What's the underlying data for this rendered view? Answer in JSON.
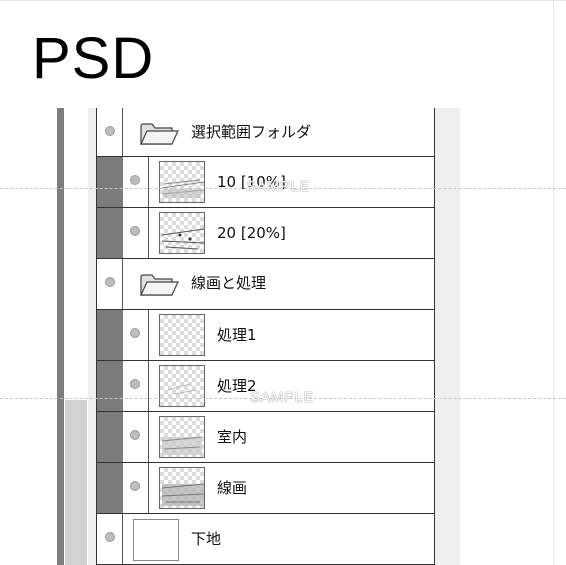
{
  "title": "PSD",
  "watermark": "SAMPLE",
  "layers": [
    {
      "name": "選択範囲フォルダ",
      "type": "folder",
      "icon": "folder-icon"
    },
    {
      "name": "10 [10%]",
      "type": "layer",
      "icon": "thumbnail"
    },
    {
      "name": "20 [20%]",
      "type": "layer",
      "icon": "thumbnail"
    },
    {
      "name": "線画と処理",
      "type": "folder",
      "icon": "folder-icon"
    },
    {
      "name": "処理1",
      "type": "layer",
      "icon": "thumbnail"
    },
    {
      "name": "処理2",
      "type": "layer",
      "icon": "thumbnail"
    },
    {
      "name": "室内",
      "type": "layer",
      "icon": "thumbnail"
    },
    {
      "name": "線画",
      "type": "layer",
      "icon": "thumbnail"
    },
    {
      "name": "下地",
      "type": "layer",
      "icon": "thumbnail"
    }
  ],
  "colors": {
    "rail": "#7d7d7d",
    "panel": "#efefef",
    "border": "#333333"
  }
}
